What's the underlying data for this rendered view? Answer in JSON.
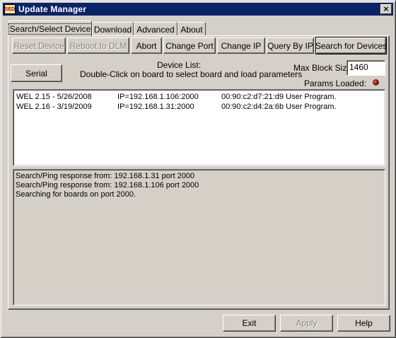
{
  "window": {
    "title": "Update Manager",
    "icon_text": "SED",
    "close_symbol": "×"
  },
  "tabs": [
    {
      "label": "Search/Select Device"
    },
    {
      "label": "Download"
    },
    {
      "label": "Advanced"
    },
    {
      "label": "About"
    }
  ],
  "toolbar": {
    "reset_device": "Reset Device",
    "reboot_dlm": "Reboot to DLM",
    "abort": "Abort",
    "change_port": "Change Port",
    "change_ip": "Change IP",
    "query_by_ip": "Query By IP",
    "search_for_devices": "Search for Devices"
  },
  "serial_button": "Serial",
  "device_list": {
    "title": "Device List:",
    "instruction": "Double-Click on board to select board and load parameters",
    "rows": [
      {
        "name": "WEL 2.15 - 5/26/2008",
        "ip": "IP=192.168.1.106:2000",
        "mac": "00:90:c2:d7:21:d9 User Program."
      },
      {
        "name": "WEL 2.16 - 3/19/2009",
        "ip": "IP=192.168.1.31:2000",
        "mac": "00:90:c2:d4:2a:6b User Program."
      }
    ]
  },
  "max_block_size": {
    "label": "Max Block Size",
    "value": "1460"
  },
  "params_loaded": {
    "label": "Params Loaded:"
  },
  "log": [
    "Search/Ping response from: 192.168.1.31 port 2000",
    "Search/Ping response from: 192.168.1.106 port 2000",
    "Searching for boards on port 2000."
  ],
  "footer": {
    "exit": "Exit",
    "apply": "Apply",
    "help": "Help"
  },
  "colors": {
    "titlebar": "#0a246a",
    "face": "#d4d0c8",
    "led": "#b00000"
  }
}
